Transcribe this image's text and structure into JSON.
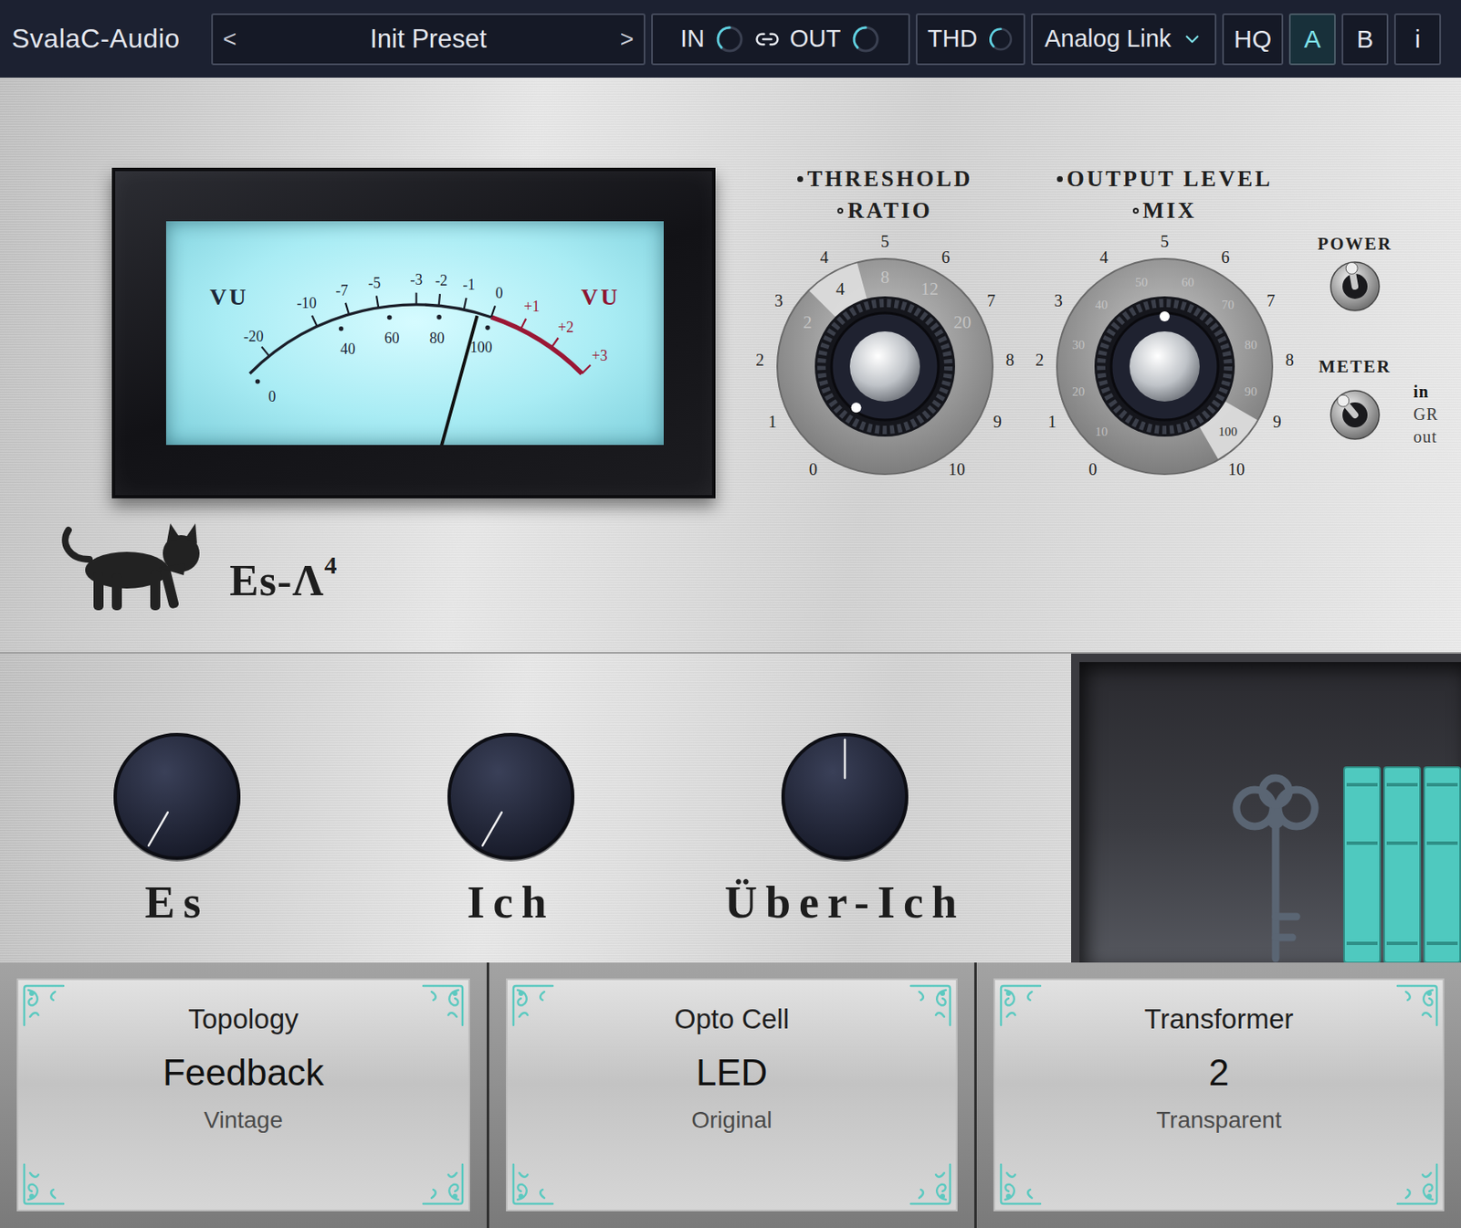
{
  "brand": "SvalaC-Audio",
  "preset": {
    "prev": "<",
    "name": "Init Preset",
    "next": ">"
  },
  "io": {
    "in": {
      "label": "IN",
      "level": 0.5
    },
    "out": {
      "label": "OUT",
      "level": 0.5
    },
    "linked": true
  },
  "thd": {
    "label": "THD",
    "level": 0.5
  },
  "link_mode": {
    "label": "Analog Link"
  },
  "buttons": [
    {
      "label": "HQ",
      "selected": false
    },
    {
      "label": "A",
      "selected": true
    },
    {
      "label": "B",
      "selected": false
    },
    {
      "label": "i",
      "selected": false
    }
  ],
  "vu_meter": {
    "left_label": "VU",
    "right_label": "VU",
    "db_scale": [
      "-20",
      "-10",
      "-7",
      "-5",
      "-3",
      "-2",
      "-1",
      "0",
      "+1",
      "+2",
      "+3"
    ],
    "percent_scale": [
      "0",
      "40",
      "60",
      "80",
      "100"
    ],
    "level": 0.67
  },
  "dials": [
    {
      "outer_label": "THRESHOLD",
      "inner_label": "RATIO",
      "level": 0,
      "outer_scale": [
        "0",
        "1",
        "2",
        "3",
        "4",
        "5",
        "6",
        "7",
        "8",
        "9",
        "10"
      ],
      "inner_scale": [
        {
          "label": "2",
          "selected": false
        },
        {
          "label": "4",
          "selected": true
        },
        {
          "label": "8",
          "selected": false
        },
        {
          "label": "12",
          "selected": false
        },
        {
          "label": "20",
          "selected": false
        }
      ]
    },
    {
      "outer_label": "OUTPUT LEVEL",
      "inner_label": "MIX",
      "level": 0.5,
      "outer_scale": [
        "0",
        "1",
        "2",
        "3",
        "4",
        "5",
        "6",
        "7",
        "8",
        "9",
        "10"
      ],
      "inner_scale": [
        {
          "label": "10",
          "selected": false
        },
        {
          "label": "20",
          "selected": false
        },
        {
          "label": "30",
          "selected": false
        },
        {
          "label": "40",
          "selected": false
        },
        {
          "label": "50",
          "selected": false
        },
        {
          "label": "60",
          "selected": false
        },
        {
          "label": "70",
          "selected": false
        },
        {
          "label": "80",
          "selected": false
        },
        {
          "label": "90",
          "selected": false
        },
        {
          "label": "100",
          "selected": true
        }
      ]
    }
  ],
  "switches": [
    {
      "label": "POWER",
      "on": true,
      "options": []
    },
    {
      "label": "METER",
      "on": true,
      "options": [
        {
          "label": "in",
          "selected": true
        },
        {
          "label": "GR",
          "selected": false
        },
        {
          "label": "out",
          "selected": false
        }
      ]
    }
  ],
  "logo": {
    "name": "Es-Λ",
    "superscript": "4"
  },
  "knobs": [
    {
      "label": "Es",
      "level": 0
    },
    {
      "label": "Ich",
      "level": 0
    },
    {
      "label": "Über-Ich",
      "level": 0.5
    }
  ],
  "cards": [
    {
      "title": "Topology",
      "value": "Feedback",
      "sub": "Vintage"
    },
    {
      "title": "Opto Cell",
      "value": "LED",
      "sub": "Original"
    },
    {
      "title": "Transformer",
      "value": "2",
      "sub": "Transparent"
    }
  ]
}
